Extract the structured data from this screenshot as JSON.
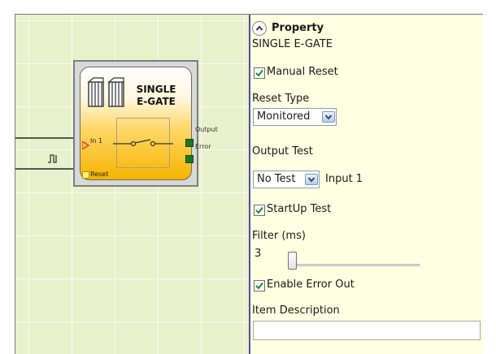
{
  "block": {
    "title_line1": "SINGLE",
    "title_line2": "E-GATE",
    "input_in1": "In 1",
    "input_reset": "Reset",
    "output_output": "Output",
    "output_error": "Error",
    "pulse_glyph": "⎍"
  },
  "panel": {
    "collapse_icon": "chevron-up-icon",
    "header": "Property",
    "block_name": "SINGLE E-GATE",
    "manual_reset": {
      "label": "Manual Reset",
      "checked": true
    },
    "reset_type": {
      "label": "Reset Type",
      "value": "Monitored"
    },
    "output_test": {
      "label": "Output Test",
      "value": "No Test",
      "input_label": "Input 1"
    },
    "startup_test": {
      "label": "StartUp Test",
      "checked": true
    },
    "filter": {
      "label": "Filter (ms)",
      "value": "3"
    },
    "enable_error_out": {
      "label": "Enable Error Out",
      "checked": true
    },
    "item_description": {
      "label": "Item Description",
      "value": ""
    }
  },
  "colors": {
    "panel_bg": "#ffffe1",
    "canvas_bg": "#e9f0cc",
    "block_orange": "#f5b400",
    "output_green": "#1a7a1a",
    "check_green": "#1e8a2e"
  }
}
